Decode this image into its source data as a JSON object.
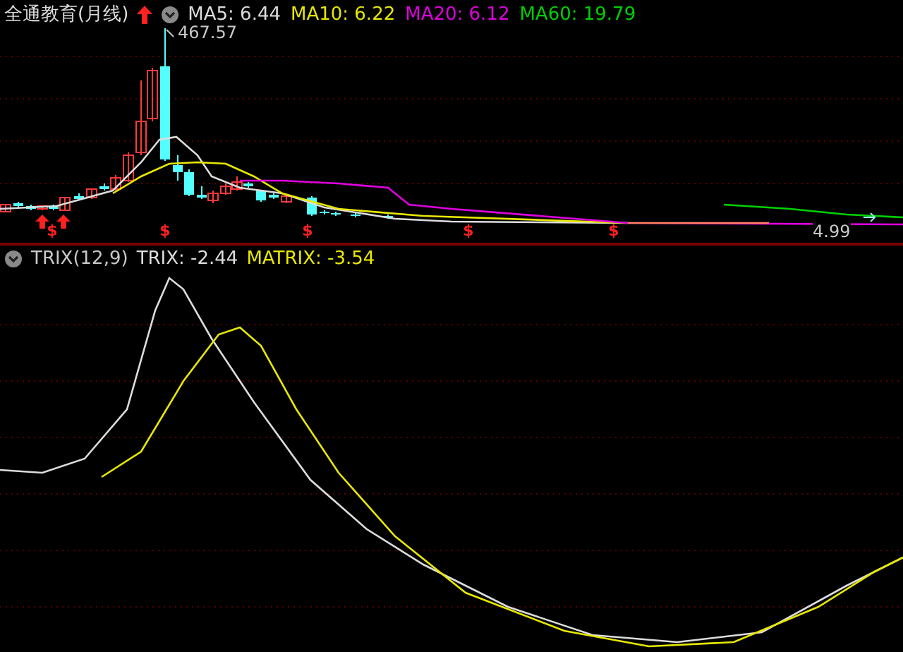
{
  "header": {
    "stock_name": "全通教育(月线)",
    "indicators": [
      {
        "label": "MA5: 6.44",
        "color": "#dcdcdc"
      },
      {
        "label": "MA10: 6.22",
        "color": "#e8e800"
      },
      {
        "label": "MA20: 6.12",
        "color": "#e000e0"
      },
      {
        "label": "MA60: 19.79",
        "color": "#00d000"
      }
    ]
  },
  "price_chart": {
    "high_label": "467.57",
    "last_label": "4.99",
    "signals": [
      "$",
      "$",
      "$",
      "$",
      "$"
    ]
  },
  "trix_panel": {
    "title": "TRIX(12,9)",
    "readings": [
      {
        "label": "TRIX: -2.44",
        "color": "#dcdcdc"
      },
      {
        "label": "MATRIX: -3.54",
        "color": "#e8e800"
      }
    ]
  }
}
